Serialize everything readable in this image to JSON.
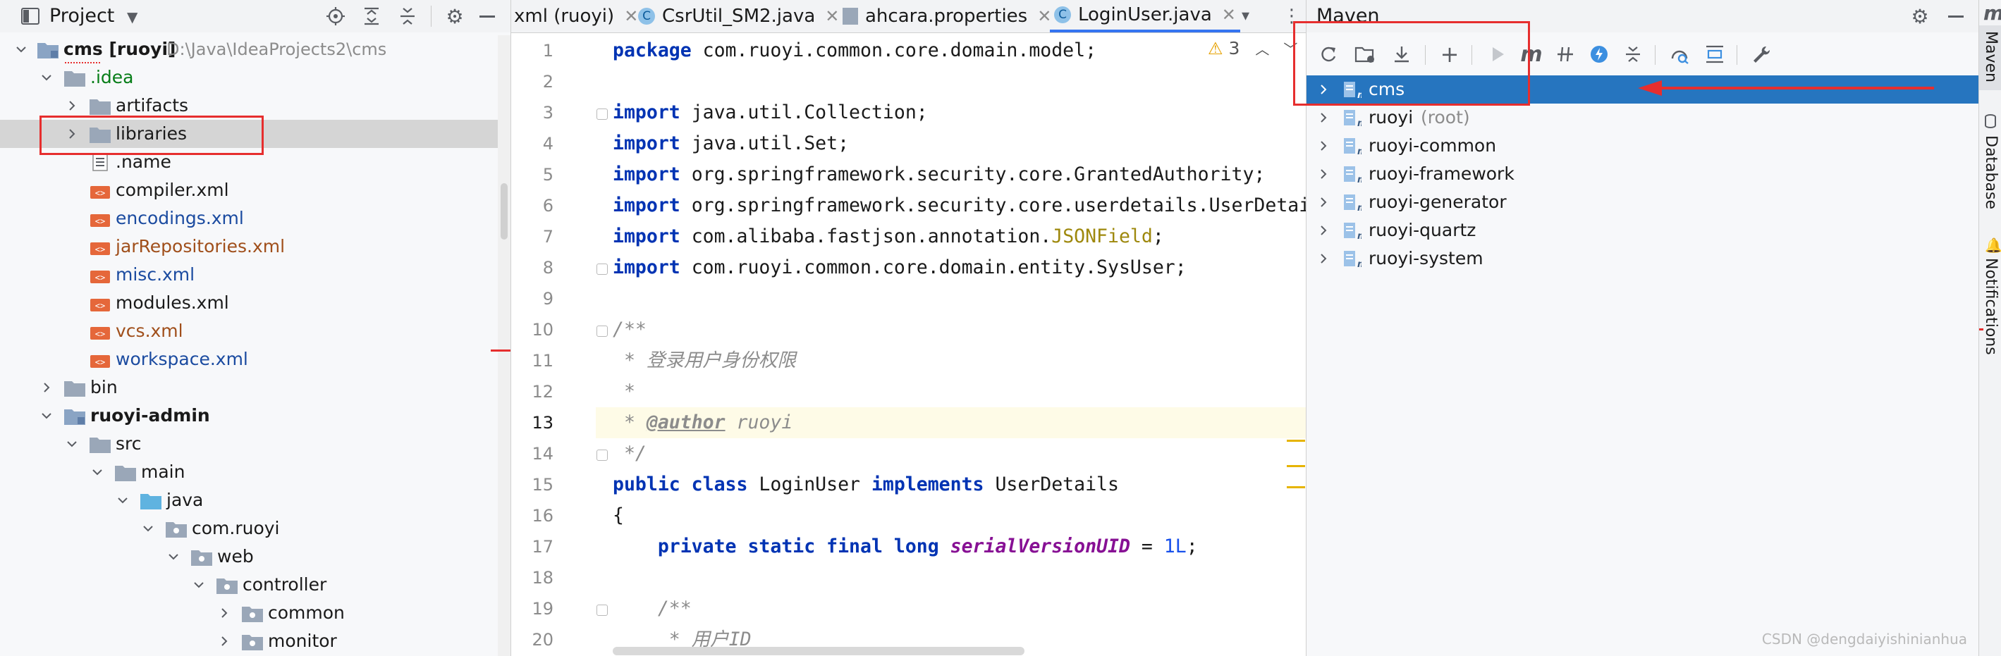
{
  "project_panel": {
    "title": "Project",
    "tree": [
      {
        "label": "cms [ruoyi]",
        "suffix": "D:\\Java\\IdeaProjects2\\cms",
        "expanded": true,
        "kind": "module",
        "bold": true
      },
      {
        "label": ".idea",
        "expanded": true,
        "kind": "folder",
        "color": "#067d17"
      },
      {
        "label": "artifacts",
        "expanded": false,
        "kind": "folder"
      },
      {
        "label": "libraries",
        "expanded": false,
        "kind": "folder",
        "selected": true
      },
      {
        "label": ".name",
        "kind": "file-text"
      },
      {
        "label": "compiler.xml",
        "kind": "file-xml"
      },
      {
        "label": "encodings.xml",
        "kind": "file-xml",
        "color": "#1b4ba0"
      },
      {
        "label": "jarRepositories.xml",
        "kind": "file-xml",
        "color": "#a04f1b"
      },
      {
        "label": "misc.xml",
        "kind": "file-xml",
        "color": "#1b4ba0"
      },
      {
        "label": "modules.xml",
        "kind": "file-xml"
      },
      {
        "label": "vcs.xml",
        "kind": "file-xml",
        "color": "#a04f1b"
      },
      {
        "label": "workspace.xml",
        "kind": "file-xml",
        "color": "#1b4ba0"
      },
      {
        "label": "bin",
        "expanded": false,
        "kind": "folder"
      },
      {
        "label": "ruoyi-admin",
        "expanded": true,
        "kind": "module",
        "bold": true
      },
      {
        "label": "src",
        "expanded": true,
        "kind": "folder"
      },
      {
        "label": "main",
        "expanded": true,
        "kind": "folder"
      },
      {
        "label": "java",
        "expanded": true,
        "kind": "folder-blue"
      },
      {
        "label": "com.ruoyi",
        "expanded": true,
        "kind": "package"
      },
      {
        "label": "web",
        "expanded": true,
        "kind": "package"
      },
      {
        "label": "controller",
        "expanded": true,
        "kind": "package"
      },
      {
        "label": "common",
        "expanded": false,
        "kind": "package"
      },
      {
        "label": "monitor",
        "expanded": false,
        "kind": "package"
      }
    ]
  },
  "editor": {
    "tabs": [
      {
        "label": "xml (ruoyi)",
        "icon": "xml-icon",
        "active": false
      },
      {
        "label": "CsrUtil_SM2.java",
        "icon": "class-icon",
        "active": false
      },
      {
        "label": "ahcara.properties",
        "icon": "properties-icon",
        "active": false
      },
      {
        "label": "LoginUser.java",
        "icon": "class-icon",
        "active": true
      }
    ],
    "warning_count": "3",
    "line_numbers": [
      "1",
      "2",
      "3",
      "4",
      "5",
      "6",
      "7",
      "8",
      "9",
      "10",
      "11",
      "12",
      "13",
      "14",
      "15",
      "16",
      "17",
      "18",
      "19",
      "20"
    ],
    "code": {
      "l1_kw": "package",
      "l1_rest": " com.ruoyi.common.core.domain.model;",
      "import_kw": "import",
      "l3": " java.util.Collection;",
      "l4": " java.util.Set;",
      "l5": " org.springframework.security.core.GrantedAuthority;",
      "l6": " org.springframework.security.core.userdetails.UserDetai",
      "l7a": " com.alibaba.fastjson.annotation.",
      "l7b": "JSONField",
      "l7c": ";",
      "l8": " com.ruoyi.common.core.domain.entity.SysUser;",
      "l10": "/**",
      "l11": " * 登录用户身份权限",
      "l12": " *",
      "l13a": " * ",
      "l13b": "@author",
      "l13c": " ruoyi",
      "l14": " */",
      "l15a": "public class",
      "l15b": " LoginUser ",
      "l15c": "implements",
      "l15d": " UserDetails",
      "l16": "{",
      "l17a": "    private static final long ",
      "l17b": "serialVersionUID",
      "l17c": " = ",
      "l17d": "1L",
      "l17e": ";",
      "l19": "    /**",
      "l20": "     * 用户ID"
    }
  },
  "maven_panel": {
    "title": "Maven",
    "toolbar_icons": [
      "reload-icon",
      "add-folder-icon",
      "download-icon",
      "plus-icon",
      "run-icon",
      "maven-m-icon",
      "skip-tests-icon",
      "lightning-icon",
      "collapse-icon",
      "analyze-icon",
      "expand-icon",
      "wrench-icon"
    ],
    "projects": [
      {
        "label": "cms",
        "suffix": "",
        "selected": true
      },
      {
        "label": "ruoyi",
        "suffix": "(root)",
        "selected": false
      },
      {
        "label": "ruoyi-common",
        "suffix": "",
        "selected": false
      },
      {
        "label": "ruoyi-framework",
        "suffix": "",
        "selected": false
      },
      {
        "label": "ruoyi-generator",
        "suffix": "",
        "selected": false
      },
      {
        "label": "ruoyi-quartz",
        "suffix": "",
        "selected": false
      },
      {
        "label": "ruoyi-system",
        "suffix": "",
        "selected": false
      }
    ]
  },
  "side_stripe": {
    "items": [
      "Maven",
      "Database",
      "Notifications"
    ],
    "top_glyph": "m"
  },
  "watermark": "CSDN @dengdaiyishinianhua",
  "colors": {
    "selection": "#2675bf",
    "annotation_red": "#e62e2e",
    "keyword": "#0033b3"
  }
}
